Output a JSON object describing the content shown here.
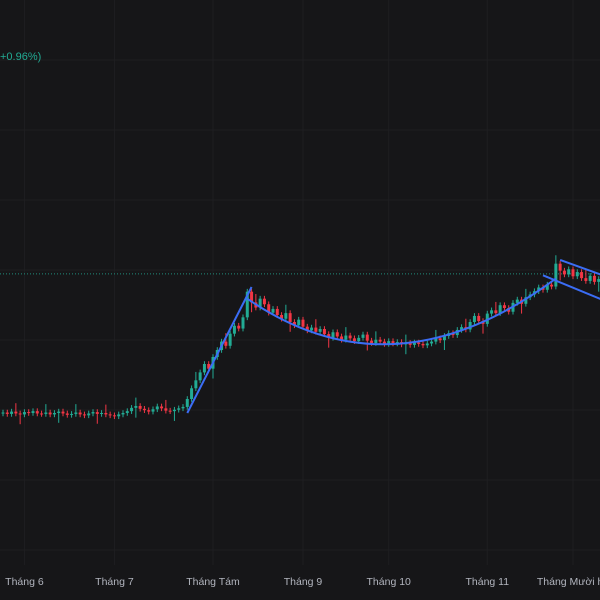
{
  "legend": {
    "change_text": "+0.96%)"
  },
  "colors": {
    "background": "#161618",
    "up": "#22ab94",
    "down": "#f23645",
    "trendline": "#3b6df5",
    "price_line": "#22ab94",
    "grid": "#1e1e21"
  },
  "chart_data": {
    "type": "candlestick",
    "title": "",
    "xlabel": "",
    "ylabel": "",
    "ylim": [
      0,
      120
    ],
    "x_tick_labels": [
      "Tháng 6",
      "Tháng 7",
      "Tháng Tám",
      "Tháng 9",
      "Tháng 10",
      "Tháng 11",
      "Tháng Mười ha"
    ],
    "x_tick_candle_index": [
      5,
      26,
      49,
      70,
      90,
      113,
      133
    ],
    "current_price_line": 61.3,
    "closes": [
      31.6,
      31.3,
      31.8,
      31.4,
      31.2,
      31.7,
      31.5,
      31.9,
      31.4,
      31.3,
      31.6,
      31.2,
      31.5,
      31.8,
      31.4,
      31.1,
      31.3,
      31.6,
      31.2,
      31.0,
      31.4,
      31.7,
      31.3,
      31.5,
      31.2,
      31.0,
      30.8,
      31.2,
      31.5,
      31.9,
      32.6,
      33.0,
      32.4,
      32.1,
      31.8,
      32.3,
      32.9,
      32.5,
      32.0,
      31.9,
      32.2,
      32.5,
      32.8,
      34.5,
      36.8,
      38.5,
      40.2,
      42.0,
      41.0,
      43.5,
      45.0,
      46.8,
      45.9,
      48.5,
      50.2,
      49.6,
      52.0,
      57.5,
      55.2,
      54.1,
      56.0,
      54.8,
      53.0,
      53.8,
      52.5,
      51.7,
      52.9,
      51.0,
      50.3,
      51.5,
      50.0,
      49.2,
      49.8,
      48.9,
      49.5,
      48.4,
      47.6,
      48.8,
      47.9,
      47.2,
      48.1,
      47.5,
      46.9,
      47.6,
      48.3,
      47.0,
      46.5,
      47.2,
      46.8,
      46.3,
      46.9,
      46.4,
      46.7,
      46.2,
      46.5,
      46.1,
      46.6,
      46.3,
      46.0,
      46.4,
      46.8,
      47.5,
      47.1,
      48.0,
      48.6,
      48.2,
      49.3,
      49.9,
      49.4,
      51.0,
      52.3,
      51.2,
      50.6,
      52.8,
      53.5,
      52.9,
      54.6,
      54.0,
      53.2,
      55.1,
      55.8,
      54.9,
      56.3,
      56.9,
      57.6,
      58.4,
      57.9,
      59.0,
      58.6,
      63.5,
      62.0,
      61.2,
      62.3,
      60.8,
      61.7,
      60.4,
      59.8,
      60.9,
      59.6,
      60.2
    ],
    "trendlines": [
      {
        "name": "breakout-line",
        "from": [
          43,
          31.5
        ],
        "to": [
          58,
          58.5
        ]
      },
      {
        "name": "cup-curve",
        "from": [
          57,
          56.0
        ],
        "control": [
          91,
          34.5
        ],
        "to": [
          129,
          60.3
        ]
      },
      {
        "name": "channel-top",
        "from": [
          130,
          64.3
        ],
        "to": [
          140,
          61.0
        ]
      },
      {
        "name": "channel-bottom",
        "from": [
          126,
          61.0
        ],
        "to": [
          140,
          55.7
        ]
      }
    ]
  }
}
